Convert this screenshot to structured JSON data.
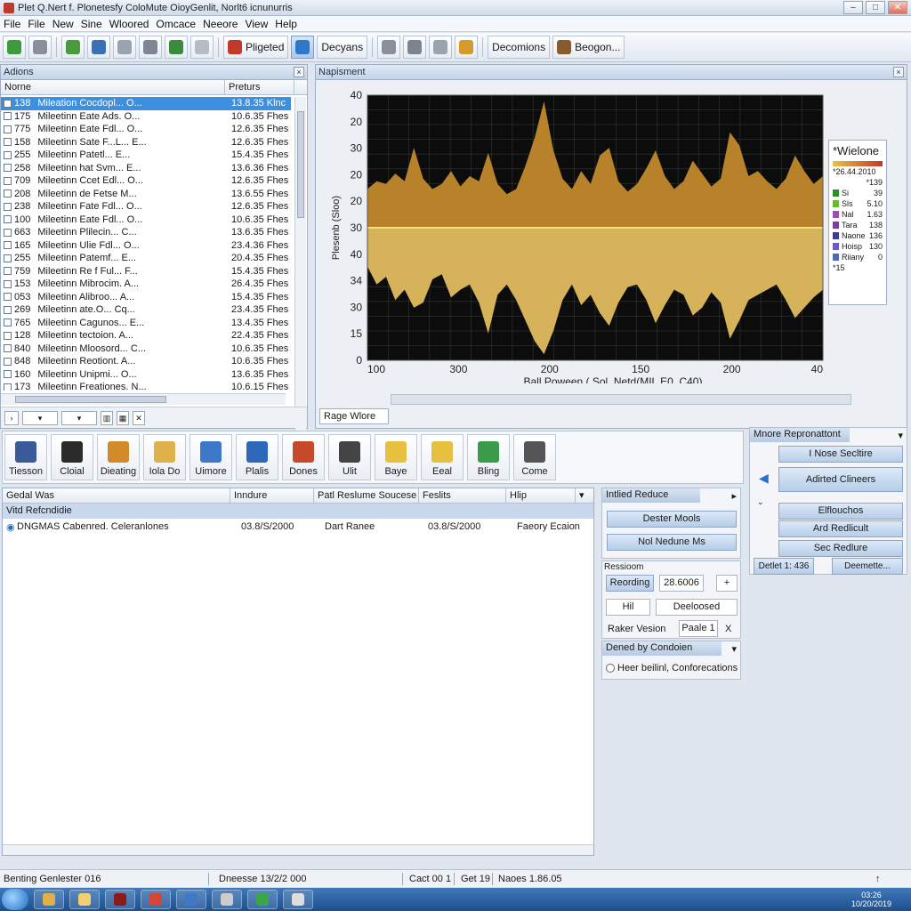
{
  "window": {
    "title": "Plet Q.Nert f. Plonetesfy ColoMute OioyGenlit, Norlt6 icnunurris",
    "controls": [
      "–",
      "□",
      "✕"
    ]
  },
  "menu": [
    "File",
    "File",
    "New",
    "Sine",
    "Wloored",
    "Omcace",
    "Neeore",
    "View",
    "Help"
  ],
  "toolbar": {
    "buttons": [
      {
        "label": "",
        "icon": "recycle-icon",
        "color": "#3a9b3a"
      },
      {
        "label": "",
        "icon": "clipboard-icon",
        "color": "#8a8f99"
      },
      {
        "label": "",
        "icon": "pencil-icon",
        "color": "#4a9b3a"
      },
      {
        "label": "",
        "icon": "grid-icon",
        "color": "#3b6fb6"
      },
      {
        "label": "",
        "icon": "window-icon",
        "color": "#9aa3ae"
      },
      {
        "label": "",
        "icon": "display-icon",
        "color": "#7d8794"
      },
      {
        "label": "",
        "icon": "link-icon",
        "color": "#3a8b3a"
      },
      {
        "label": "",
        "icon": "cylinder-icon",
        "color": "#b6bcc4"
      },
      {
        "label": "Pligeted",
        "icon": "tag-icon",
        "color": "#c0392b"
      },
      {
        "label": "",
        "icon": "globe-icon",
        "color": "#2f78c9"
      },
      {
        "label": "Decyans",
        "icon": "",
        "color": ""
      },
      {
        "label": "",
        "icon": "print-icon",
        "color": "#8a9099"
      },
      {
        "label": "",
        "icon": "tools-icon",
        "color": "#7b8592"
      },
      {
        "label": "",
        "icon": "search-icon",
        "color": "#9ba4ae"
      },
      {
        "label": "",
        "icon": "note-icon",
        "color": "#d49b2a"
      },
      {
        "label": "Decomions",
        "icon": "",
        "color": ""
      },
      {
        "label": "Beogon...",
        "icon": "brush-icon",
        "color": "#8b5a2b"
      }
    ]
  },
  "actions": {
    "title": "Adions",
    "columns": [
      "Norne",
      "Preturs"
    ],
    "rows": [
      {
        "id": "138",
        "name": "Mileation Cocdopl... O...",
        "size": "13.8.35 Klnc",
        "selected": true
      },
      {
        "id": "175",
        "name": "Mileetinn Eate Ads. O...",
        "size": "10.6.35 Fhes"
      },
      {
        "id": "775",
        "name": "Mileetinn Eate Fdl... O...",
        "size": "12.6.35 Fhes"
      },
      {
        "id": "158",
        "name": "Mileetinn Sate F...L... E...",
        "size": "12.6.35 Fhes"
      },
      {
        "id": "255",
        "name": "Mileetinn Patetl... E...",
        "size": "15.4.35 Fhes"
      },
      {
        "id": "258",
        "name": "Mileetinn hat Svm... E...",
        "size": "13.6.36 Fhes"
      },
      {
        "id": "709",
        "name": "Mileetinn Ccet Edl... O...",
        "size": "12.6.35 Fhes"
      },
      {
        "id": "208",
        "name": "Mileetinn de Fetse M...",
        "size": "13.6.55 Fhes"
      },
      {
        "id": "238",
        "name": "Mileetinn Fate Fdl... O...",
        "size": "12.6.35 Fhes"
      },
      {
        "id": "100",
        "name": "Mileetinn Eate Fdl... O...",
        "size": "10.6.35 Fhes"
      },
      {
        "id": "663",
        "name": "Mileetinn Plilecin... C...",
        "size": "13.6.35 Fhes"
      },
      {
        "id": "165",
        "name": "Mileetinn Ulie Fdl... O...",
        "size": "23.4.36 Fhes"
      },
      {
        "id": "255",
        "name": "Mileetinn Patemf... E...",
        "size": "20.4.35 Fhes"
      },
      {
        "id": "759",
        "name": "Mileetinn Re f Ful... F...",
        "size": "15.4.35 Fhes"
      },
      {
        "id": "153",
        "name": "Mileetinn Mibrocim. A...",
        "size": "26.4.35 Fhes"
      },
      {
        "id": "053",
        "name": "Mileetinn Alibroo... A...",
        "size": "15.4.35 Fhes"
      },
      {
        "id": "269",
        "name": "Mileetinn ate.O... Cq...",
        "size": "23.4.35 Fhes"
      },
      {
        "id": "765",
        "name": "Mileetinn Cagunos... E...",
        "size": "13.4.35 Fhes"
      },
      {
        "id": "128",
        "name": "Mileetinn tectoion. A...",
        "size": "22.4.35 Fhes"
      },
      {
        "id": "840",
        "name": "Mileetinn Mloosord... C...",
        "size": "10.6.35 Fhes"
      },
      {
        "id": "848",
        "name": "Mileetinn Reotiont. A...",
        "size": "10.6.35 Fhes"
      },
      {
        "id": "160",
        "name": "Mileetinn Unipmi... O...",
        "size": "13.6.35 Fhes"
      },
      {
        "id": "173",
        "name": "Mileetinn Freationes. N...",
        "size": "10.6.15 Fhes"
      }
    ]
  },
  "waveform": {
    "title": "Napisment",
    "tab_label": "Rage Wlore",
    "legend": {
      "title": "*Wielone",
      "range": "*26.44.2010",
      "head_value": "*139",
      "items": [
        {
          "label": "Si",
          "value": "39",
          "color": "#2e8b2e"
        },
        {
          "label": "Sls",
          "value": "5.10",
          "color": "#66bb33"
        },
        {
          "label": "Nal",
          "value": "1.63",
          "color": "#9b4fb0"
        },
        {
          "label": "Tara",
          "value": "138",
          "color": "#7a3fa0"
        },
        {
          "label": "Naone",
          "value": "136",
          "color": "#3c3c9b"
        },
        {
          "label": "Hoisp",
          "value": "130",
          "color": "#6a5acd"
        },
        {
          "label": "Riiany",
          "value": "0",
          "color": "#4a6ab3"
        },
        {
          "label": "*15",
          "value": "",
          "color": ""
        }
      ]
    }
  },
  "chart_data": {
    "type": "area",
    "title": "",
    "xlabel": "Ball Poween ( Sol, Netd(MIL E0. C40)",
    "ylabel": "Plesenb (Sloo)",
    "x_tick_labels": [
      "100",
      "300",
      "200",
      "150",
      "200",
      "40"
    ],
    "y_tick_labels": [
      "40",
      "20",
      "30",
      "20",
      "20",
      "30",
      "40",
      "34",
      "30",
      "15",
      "0"
    ],
    "grid": true,
    "background": "#0c0c0c",
    "upper_color": "#b8822b",
    "lower_color": "#d6b25a",
    "center_line_color": "#f5e27a",
    "upper_envelope": [
      0.3,
      0.36,
      0.34,
      0.42,
      0.36,
      0.62,
      0.38,
      0.3,
      0.34,
      0.44,
      0.32,
      0.4,
      0.36,
      0.58,
      0.34,
      0.26,
      0.3,
      0.48,
      0.7,
      0.98,
      0.6,
      0.38,
      0.3,
      0.44,
      0.34,
      0.56,
      0.62,
      0.36,
      0.28,
      0.34,
      0.46,
      0.6,
      0.4,
      0.3,
      0.36,
      0.52,
      0.42,
      0.32,
      0.38,
      0.74,
      0.64,
      0.4,
      0.44,
      0.36,
      0.3,
      0.38,
      0.56,
      0.44,
      0.34,
      0.4
    ],
    "lower_envelope": [
      0.3,
      0.44,
      0.38,
      0.56,
      0.48,
      0.62,
      0.58,
      0.4,
      0.36,
      0.54,
      0.48,
      0.44,
      0.58,
      0.82,
      0.52,
      0.44,
      0.56,
      0.72,
      0.88,
      0.98,
      0.8,
      0.56,
      0.44,
      0.6,
      0.52,
      0.66,
      0.76,
      0.58,
      0.46,
      0.44,
      0.56,
      0.74,
      0.6,
      0.48,
      0.52,
      0.68,
      0.62,
      0.5,
      0.58,
      0.86,
      0.72,
      0.56,
      0.52,
      0.48,
      0.44,
      0.56,
      0.7,
      0.62,
      0.54,
      0.48
    ]
  },
  "icon_toolbar": [
    {
      "label": "Tiesson",
      "icon": "cursor-icon",
      "color": "#3b5a9a"
    },
    {
      "label": "Cloial",
      "icon": "terminal-icon",
      "color": "#2b2b2b"
    },
    {
      "label": "Dieating",
      "icon": "package-icon",
      "color": "#d28a2a"
    },
    {
      "label": "Iola Do",
      "icon": "folder-icon",
      "color": "#e0b04a"
    },
    {
      "label": "Uimore",
      "icon": "document-icon",
      "color": "#3d78c9"
    },
    {
      "label": "Plalis",
      "icon": "monitor-icon",
      "color": "#2e68b8"
    },
    {
      "label": "Dones",
      "icon": "fruit-icon",
      "color": "#c44a2a"
    },
    {
      "label": "Ulit",
      "icon": "printer-icon",
      "color": "#444"
    },
    {
      "label": "Baye",
      "icon": "file-icon",
      "color": "#e8c040"
    },
    {
      "label": "Eeal",
      "icon": "file-icon",
      "color": "#e8c040"
    },
    {
      "label": "Bling",
      "icon": "compass-icon",
      "color": "#3a9b4a"
    },
    {
      "label": "Come",
      "icon": "magnifier-icon",
      "color": "#555"
    }
  ],
  "results": {
    "columns": [
      "Gedal Was",
      "Inndure",
      "Patl Reslume Soucese",
      "Feslits",
      "Hlip"
    ],
    "group": "Vitd Refcndidie",
    "rows": [
      {
        "name": "DNGMAS Cabenred. Celeranlones",
        "date": "03.8/S/2000",
        "source": "Dart Ranee",
        "value": "03.8/S/2000",
        "hint": "Faeory Ecaion"
      }
    ]
  },
  "side_panel": {
    "initial_header": "Intlied Reduce",
    "btn_dester": "Dester Mools",
    "btn_nol": "Nol Nedune Ms",
    "record_header": "Ressioom",
    "recording": "Reording",
    "rec_value": "28.6006",
    "rec_plus": "+",
    "hil": "Hil",
    "deeloosed": "Deeloosed",
    "raker": "Raker Vesion",
    "page": "Paale 1",
    "page_x": "X",
    "dened_header": "Dened by Condoien",
    "option": "Heer beilinl, Conforecations"
  },
  "minor_panel": {
    "title": "Mnore Repronattont",
    "btn_nose": "I Nose Secltire",
    "btn_adh": "Adirted Clineers",
    "btn_eiflor": "Elflouchos",
    "btn_ard": "Ard Redlicult",
    "btn_sec": "Sec Redlure",
    "tab_detalt": "Detlet 1: 436",
    "tab_deem": "Deemette..."
  },
  "statusbar": {
    "left": "Benting Genlester 016",
    "mid": "Dneesse 13/2/2 000",
    "cact": "Cact 00 1",
    "get": "Get 19",
    "naoes": "Naoes 1.86.05"
  },
  "taskbar": {
    "time": "03:26",
    "date": "10/20/2019",
    "apps": [
      {
        "icon": "folder-icon",
        "color": "#e0b04a"
      },
      {
        "icon": "notepad-icon",
        "color": "#f0d070"
      },
      {
        "icon": "media-icon",
        "color": "#8b1a1a"
      },
      {
        "icon": "chrome-icon",
        "color": "#d44638"
      },
      {
        "icon": "monitor-icon",
        "color": "#3d78c9"
      },
      {
        "icon": "document-icon",
        "color": "#cccccc"
      },
      {
        "icon": "chart-icon",
        "color": "#3aa64a"
      },
      {
        "icon": "gear-icon",
        "color": "#dddddd"
      }
    ]
  }
}
